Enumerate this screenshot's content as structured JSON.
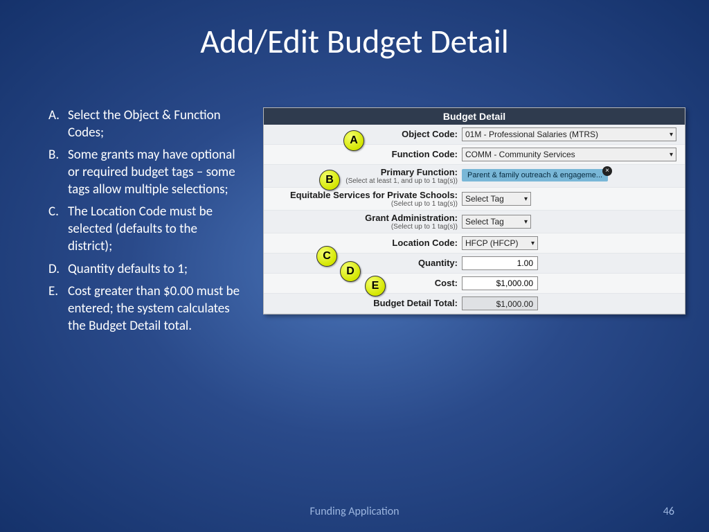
{
  "title": "Add/Edit Budget Detail",
  "list": {
    "items": [
      {
        "marker": "A.",
        "text": "Select the Object & Function Codes;"
      },
      {
        "marker": "B.",
        "text": "Some grants may have optional or required budget tags – some tags allow multiple selections;"
      },
      {
        "marker": "C.",
        "text": "The Location Code must be selected (defaults to the district);"
      },
      {
        "marker": "D.",
        "text": "Quantity defaults to 1;"
      },
      {
        "marker": "E.",
        "text": "Cost greater than $0.00 must be entered; the system calculates the Budget Detail total."
      }
    ]
  },
  "panel": {
    "header": "Budget Detail",
    "rows": {
      "object_code": {
        "label": "Object Code:",
        "value": "01M - Professional Salaries (MTRS)"
      },
      "function_code": {
        "label": "Function Code:",
        "value": "COMM - Community Services"
      },
      "primary_function": {
        "label": "Primary Function:",
        "hint": "(Select at least 1, and up to 1 tag(s))",
        "tag": "Parent & family outreach & engageme..."
      },
      "equitable": {
        "label": "Equitable Services for Private Schools:",
        "hint": "(Select up to 1 tag(s))",
        "value": "Select Tag"
      },
      "grant_admin": {
        "label": "Grant Administration:",
        "hint": "(Select up to 1 tag(s))",
        "value": "Select Tag"
      },
      "location_code": {
        "label": "Location Code:",
        "value": "HFCP (HFCP)"
      },
      "quantity": {
        "label": "Quantity:",
        "value": "1.00"
      },
      "cost": {
        "label": "Cost:",
        "value": "$1,000.00"
      },
      "total": {
        "label": "Budget Detail Total:",
        "value": "$1,000.00"
      }
    },
    "bubbles": {
      "a": "A",
      "b": "B",
      "c": "C",
      "d": "D",
      "e": "E"
    }
  },
  "footer": {
    "label": "Funding Application",
    "page": "46"
  }
}
